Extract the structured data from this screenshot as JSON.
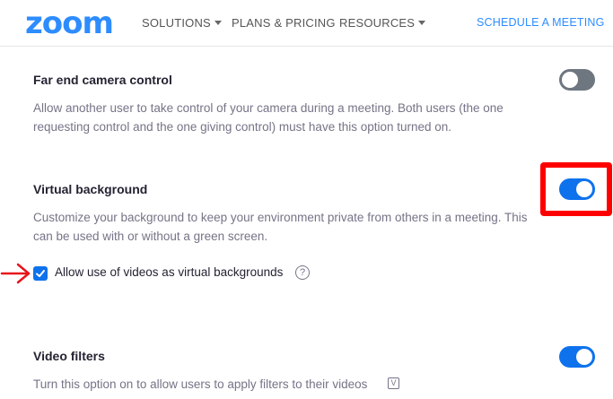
{
  "header": {
    "logo": "zoom",
    "nav": {
      "solutions": "SOLUTIONS",
      "plans": "PLANS & PRICING",
      "resources": "RESOURCES",
      "schedule": "SCHEDULE A MEETING"
    }
  },
  "settings": {
    "far_end": {
      "title": "Far end camera control",
      "description": "Allow another user to take control of your camera during a meeting. Both users (the one requesting control and the one giving control) must have this option turned on.",
      "enabled": false
    },
    "virtual_background": {
      "title": "Virtual background",
      "description": "Customize your background to keep your environment private from others in a meeting. This can be used with or without a green screen.",
      "enabled": true,
      "sub_option": {
        "label": "Allow use of videos as virtual backgrounds",
        "checked": true,
        "help_glyph": "?"
      }
    },
    "video_filters": {
      "title": "Video filters",
      "description": "Turn this option on to allow users to apply filters to their videos",
      "enabled": true,
      "badge_glyph": "V"
    }
  },
  "annotations": {
    "highlight_color": "#ff0000",
    "arrow_color": "#e8141b"
  },
  "colors": {
    "brand": "#2d8cff",
    "toggle_on": "#0e72ed",
    "toggle_off": "#6e7680"
  }
}
